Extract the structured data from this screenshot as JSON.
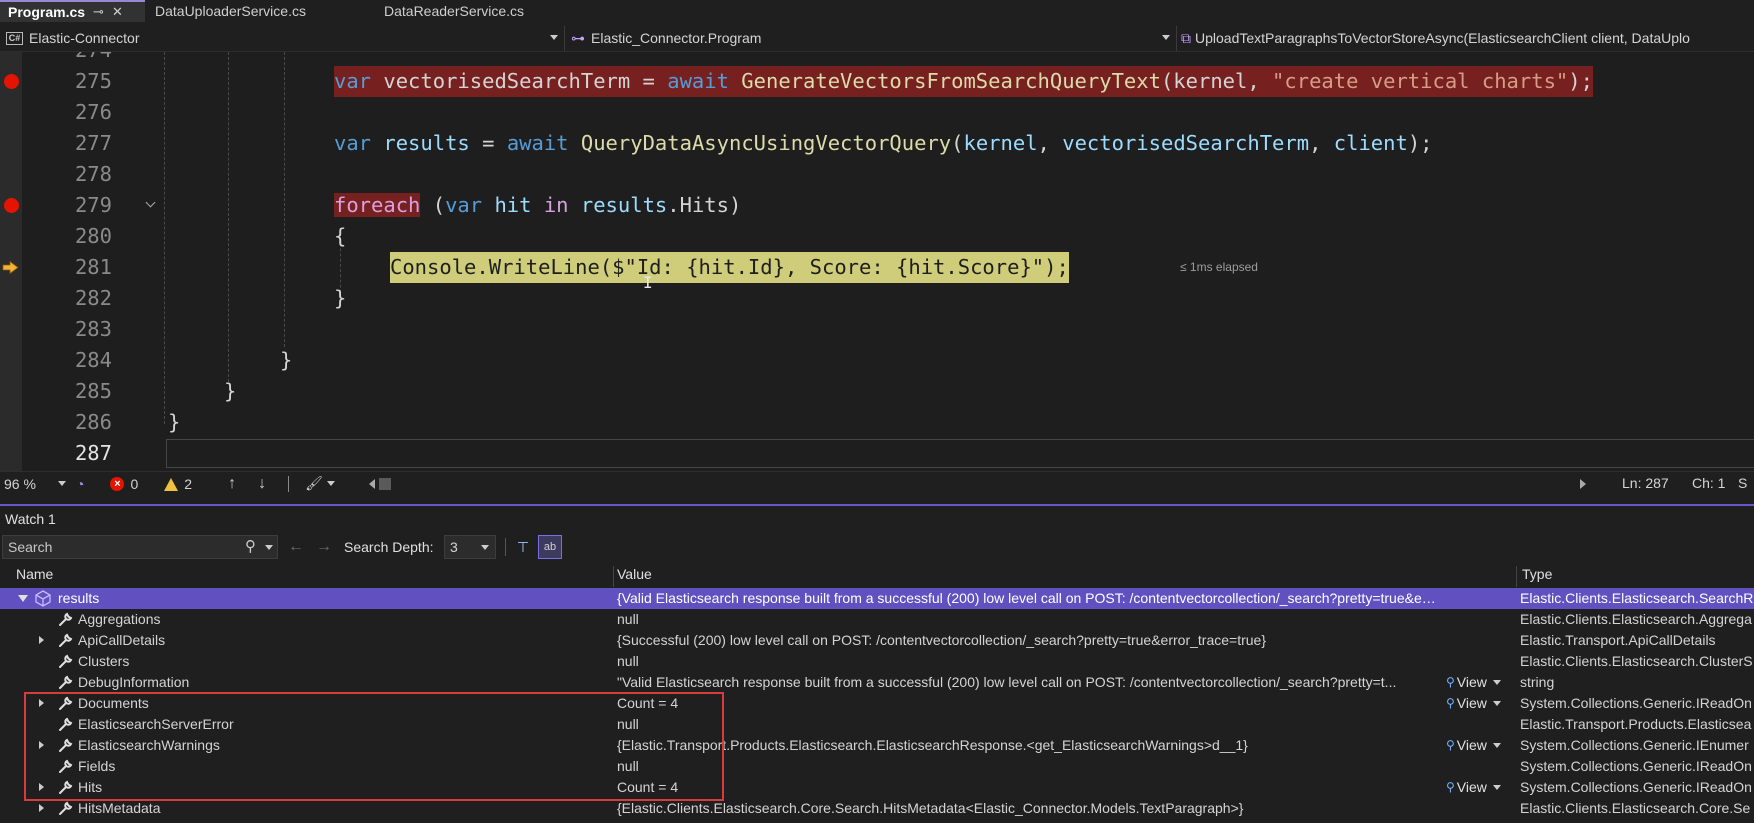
{
  "tabs": [
    {
      "label": "Program.cs",
      "pin": "⊸",
      "close": "✕"
    },
    {
      "label": "DataUploaderService.cs"
    },
    {
      "label": "DataReaderService.cs"
    }
  ],
  "navbar": {
    "project_icon": "C#",
    "project": "Elastic-Connector",
    "type_icon": "⊶",
    "class": "Elastic_Connector.Program",
    "method": "UploadTextParagraphsToVectorStoreAsync(ElasticsearchClient client, DataUplo"
  },
  "editor": {
    "top_partial_line": "274",
    "lines": [
      {
        "n": "275",
        "breakpoint": true
      },
      {
        "n": "276"
      },
      {
        "n": "277"
      },
      {
        "n": "278"
      },
      {
        "n": "279",
        "breakpoint": true,
        "foldable": true
      },
      {
        "n": "280"
      },
      {
        "n": "281",
        "current": true
      },
      {
        "n": "282"
      },
      {
        "n": "283"
      },
      {
        "n": "284"
      },
      {
        "n": "285"
      },
      {
        "n": "286"
      },
      {
        "n": "287",
        "cursor_line": true
      }
    ],
    "code": {
      "l275": {
        "var": "var",
        "name": " vectorisedSearchTerm = ",
        "await": "await",
        "fn": " GenerateVectorsFromSearchQueryText",
        "args": "(kernel, ",
        "str": "\"create vertical charts\"",
        "end": ");"
      },
      "l277": {
        "var": "var",
        "name": "results",
        "eq": " = ",
        "await": "await",
        "fn": "QueryDataAsyncUsingVectorQuery",
        "p1": "kernel",
        "p2": "vectorisedSearchTerm",
        "p3": "client",
        "end": ");"
      },
      "l279": {
        "foreach": "foreach",
        "open": " (",
        "var": "var",
        "hit": "hit",
        "in": "in",
        "results": "results",
        "hits": ".Hits)"
      },
      "l280": "{",
      "l281": "Console.WriteLine($\"Id: {hit.Id}, Score: {hit.Score}\");",
      "l281_elapsed": "≤ 1ms elapsed",
      "l282": "}",
      "l284": "}",
      "l285": "}",
      "l286": "}"
    }
  },
  "status": {
    "zoom": "96 %",
    "errors": "0",
    "warnings": "2",
    "line": "Ln: 287",
    "col": "Ch: 1",
    "tail": "S"
  },
  "watch": {
    "title": "Watch 1",
    "search_placeholder": "Search",
    "search_depth_label": "Search Depth:",
    "search_depth_value": "3",
    "columns": {
      "name": "Name",
      "value": "Value",
      "type": "Type"
    },
    "view_label": "View",
    "rows": [
      {
        "name": "results",
        "value": "{Valid Elasticsearch response built from a successful (200) low level call on POST: /contentvectorcollection/_search?pretty=true&error_t...",
        "type": "Elastic.Clients.Elasticsearch.SearchR"
      },
      {
        "name": "Aggregations",
        "value": "null",
        "type": "Elastic.Clients.Elasticsearch.Aggrega"
      },
      {
        "name": "ApiCallDetails",
        "value": "{Successful (200) low level call on POST: /contentvectorcollection/_search?pretty=true&error_trace=true}",
        "type": "Elastic.Transport.ApiCallDetails"
      },
      {
        "name": "Clusters",
        "value": "null",
        "type": "Elastic.Clients.Elasticsearch.ClusterS"
      },
      {
        "name": "DebugInformation",
        "value": "\"Valid Elasticsearch response built from a successful (200) low level call on POST: /contentvectorcollection/_search?pretty=t...",
        "type": "string"
      },
      {
        "name": "Documents",
        "value": "Count = 4",
        "type": "System.Collections.Generic.IReadOn"
      },
      {
        "name": "ElasticsearchServerError",
        "value": "null",
        "type": "Elastic.Transport.Products.Elasticsea"
      },
      {
        "name": "ElasticsearchWarnings",
        "value": "{Elastic.Transport.Products.Elasticsearch.ElasticsearchResponse.<get_ElasticsearchWarnings>d__1}",
        "type": "System.Collections.Generic.IEnumer"
      },
      {
        "name": "Fields",
        "value": "null",
        "type": "System.Collections.Generic.IReadOn"
      },
      {
        "name": "Hits",
        "value": "Count = 4",
        "type": "System.Collections.Generic.IReadOn"
      },
      {
        "name": "HitsMetadata",
        "value": "{Elastic.Clients.Elasticsearch.Core.Search.HitsMetadata<Elastic_Connector.Models.TextParagraph>}",
        "type": "Elastic.Clients.Elasticsearch.Core.Se"
      }
    ]
  },
  "colors": {
    "breakpoint": "#e51400",
    "breakpoint_highlight": "#772020",
    "current_statement": "#cfcc7a",
    "selection": "#6050c0",
    "annotation_box": "#d63c3c"
  }
}
